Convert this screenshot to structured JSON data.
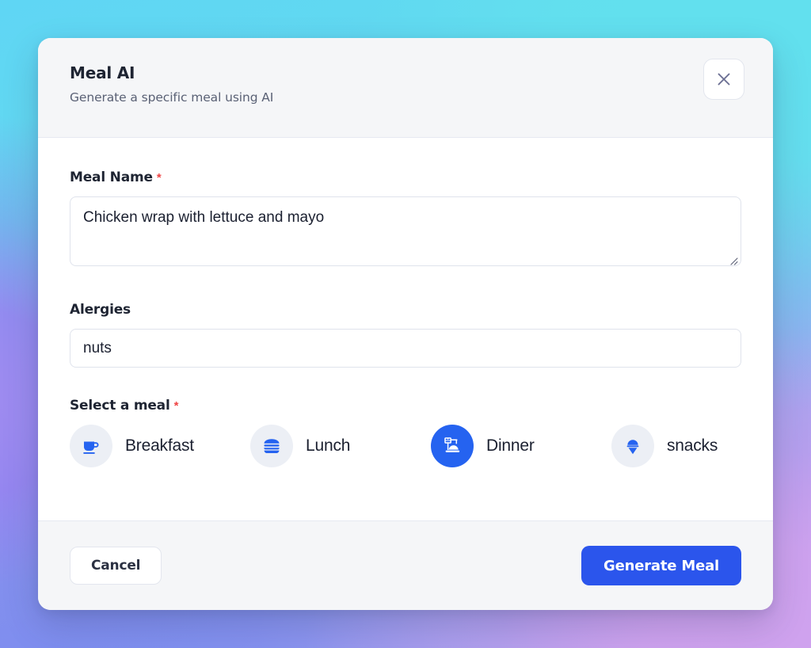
{
  "background": {
    "colors": [
      "#5fd6f4",
      "#62e0ee",
      "#7b8df0",
      "#a48cf0",
      "#cfa2ee"
    ]
  },
  "dialog": {
    "header": {
      "title": "Meal AI",
      "subtitle": "Generate a specific meal using AI",
      "close_icon": "close-icon"
    },
    "fields": {
      "meal_name": {
        "label": "Meal Name",
        "required_marker": "*",
        "value": "Chicken wrap with lettuce and mayo",
        "placeholder": ""
      },
      "allergies": {
        "label": "Alergies",
        "value": "nuts",
        "placeholder": ""
      },
      "select_meal": {
        "label": "Select a meal",
        "required_marker": "*",
        "selected": "Dinner",
        "options": [
          {
            "label": "Breakfast",
            "icon": "coffee-cup-icon",
            "selected": false
          },
          {
            "label": "Lunch",
            "icon": "burger-icon",
            "selected": false
          },
          {
            "label": "Dinner",
            "icon": "food-dome-icon",
            "selected": true
          },
          {
            "label": "snacks",
            "icon": "ice-cream-cone-icon",
            "selected": false
          }
        ]
      }
    },
    "footer": {
      "cancel_label": "Cancel",
      "submit_label": "Generate Meal"
    },
    "accent_color": "#2b55ec",
    "required_color": "#ef4444"
  }
}
